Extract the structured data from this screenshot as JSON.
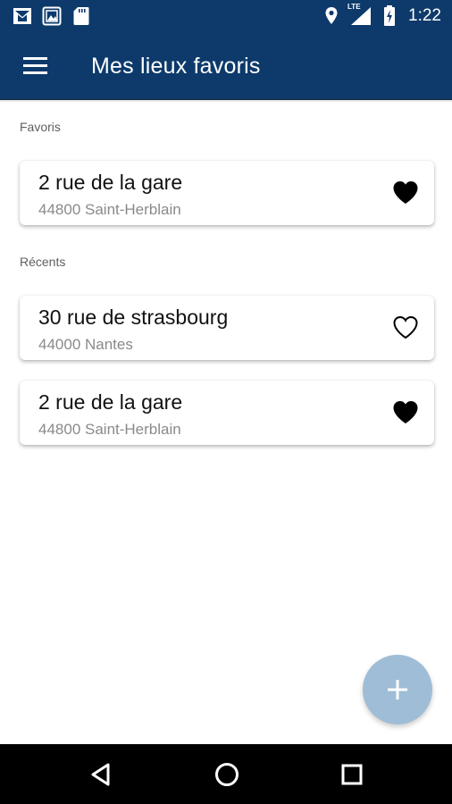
{
  "status_bar": {
    "time": "1:22",
    "network": "LTE",
    "left_icons": [
      "gmail-icon",
      "gallery-notification-icon",
      "sd-card-icon"
    ],
    "right_icons": [
      "location-icon",
      "signal-icon",
      "battery-charging-icon"
    ]
  },
  "app_bar": {
    "title": "Mes lieux favoris",
    "menu_icon": "hamburger-menu-icon"
  },
  "favorites": {
    "label": "Favoris",
    "items": [
      {
        "title": "2 rue de la gare",
        "subtitle": "44800 Saint-Herblain",
        "favorite": true
      }
    ]
  },
  "recents": {
    "label": "Récents",
    "items": [
      {
        "title": "30 rue de strasbourg",
        "subtitle": "44000 Nantes",
        "favorite": false
      },
      {
        "title": "2 rue de la gare",
        "subtitle": "44800 Saint-Herblain",
        "favorite": true
      }
    ]
  },
  "fab": {
    "icon": "plus-icon",
    "color": "#9fbdd6"
  },
  "nav_bar": {
    "icons": [
      "back-triangle-icon",
      "home-circle-icon",
      "recents-square-icon"
    ]
  },
  "colors": {
    "primary": "#0d3a6b",
    "fab": "#9fbdd6"
  }
}
